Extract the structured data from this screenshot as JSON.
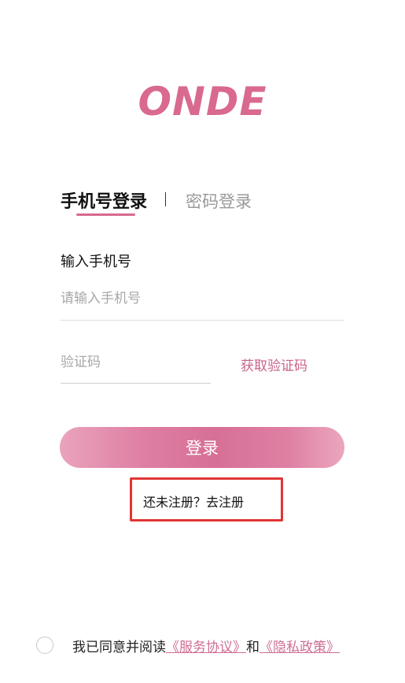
{
  "app": {
    "logo": "ONDE"
  },
  "tabs": {
    "phone_login": "手机号登录",
    "divider": "|",
    "password_login": "密码登录"
  },
  "phone": {
    "label": "输入手机号",
    "placeholder": "请输入手机号",
    "value": ""
  },
  "code": {
    "placeholder": "验证码",
    "value": "",
    "get_code": "获取验证码"
  },
  "login": {
    "button": "登录"
  },
  "register": {
    "link": "还未注册？去注册"
  },
  "agreement": {
    "checked": false,
    "text": "我已同意并阅读",
    "service_link": "《服务协议》",
    "and": "和",
    "privacy_link": "《隐私政策》"
  },
  "colors": {
    "accent": "#d9698f",
    "highlight_box": "#e03535"
  }
}
